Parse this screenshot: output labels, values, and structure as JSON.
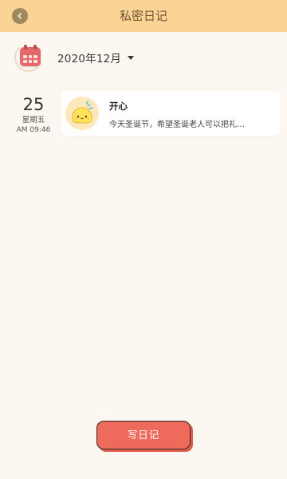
{
  "header": {
    "title": "私密日记",
    "back_icon": "chevron-left-icon"
  },
  "month_selector": {
    "label": "2020年12月",
    "icon": "calendar-icon",
    "dropdown_icon": "caret-down-icon"
  },
  "entries": [
    {
      "day": "25",
      "weekday": "星期五",
      "time": "AM 09:46",
      "mood": "开心",
      "mood_icon": "happy-face-icon",
      "excerpt": "今天圣诞节，希望圣诞老人可以把礼…"
    }
  ],
  "write_button": {
    "label": "写日记"
  },
  "colors": {
    "header_bg": "#fbd394",
    "page_bg": "#fcf8f1",
    "back_button_bg": "#a0875c",
    "accent": "#ee6b5c"
  }
}
